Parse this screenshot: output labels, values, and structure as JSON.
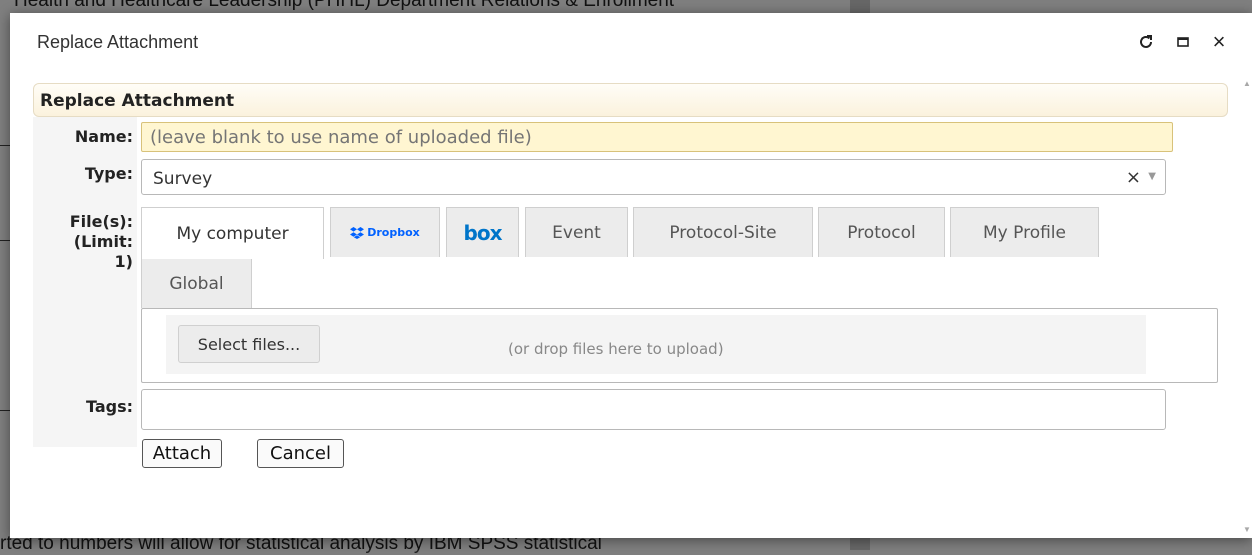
{
  "background": {
    "heading_text": "Health and Healthcare Leadership (PHHL) Department Relations & Enrollment",
    "footer_text": "rted to numbers will allow for statistical analysis by IBM SPSS statistical"
  },
  "dialog": {
    "title": "Replace Attachment",
    "icons": {
      "refresh": "refresh-icon",
      "maximize": "maximize-icon",
      "close": "close-icon"
    },
    "close_glyph": "×"
  },
  "form": {
    "section_title": "Replace Attachment",
    "name_label": "Name:",
    "name_placeholder": "(leave blank to use name of uploaded file)",
    "type_label": "Type:",
    "type_value": "Survey",
    "type_clear": "×",
    "files_label_line1": "File(s):",
    "files_label_line2": "(Limit:",
    "files_label_line3": "1)",
    "tabs": [
      {
        "label": "My computer",
        "active": true
      },
      {
        "label": "Dropbox",
        "active": false
      },
      {
        "label": "box",
        "active": false
      },
      {
        "label": "Event",
        "active": false
      },
      {
        "label": "Protocol-Site",
        "active": false
      },
      {
        "label": "Protocol",
        "active": false
      },
      {
        "label": "My Profile",
        "active": false
      },
      {
        "label": "Global",
        "active": false
      }
    ],
    "select_files_label": "Select files...",
    "drop_hint": "(or drop files here to upload)",
    "tags_label": "Tags:",
    "tags_value": "",
    "attach_label": "Attach",
    "cancel_label": "Cancel"
  },
  "colors": {
    "name_field_bg": "#fff6d1",
    "section_header_bg": "#fbf2dd",
    "dropbox_blue": "#0061ff",
    "box_blue": "#0075c9"
  }
}
